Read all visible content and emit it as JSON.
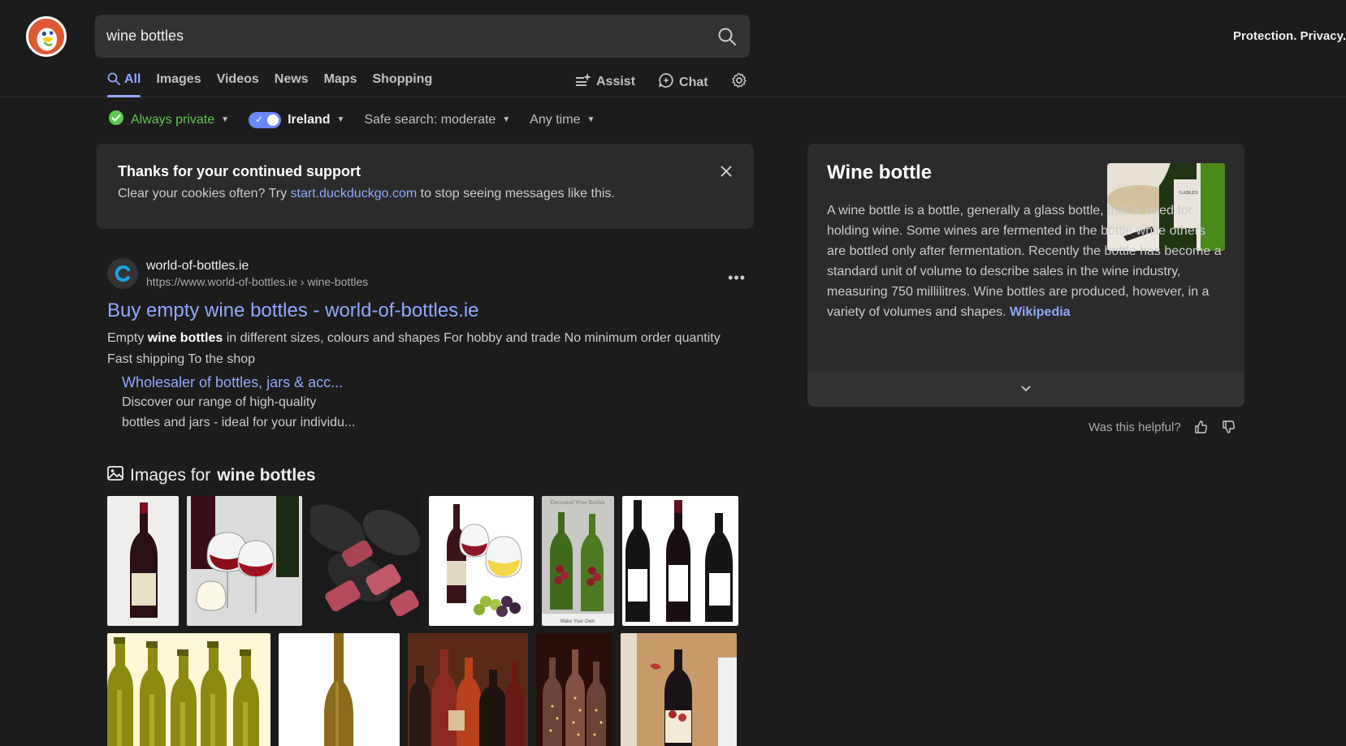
{
  "header": {
    "search_value": "wine bottles",
    "tagline": "Protection. Privacy."
  },
  "tabs": [
    {
      "label": "All",
      "active": true
    },
    {
      "label": "Images"
    },
    {
      "label": "Videos"
    },
    {
      "label": "News"
    },
    {
      "label": "Maps"
    },
    {
      "label": "Shopping"
    }
  ],
  "tools": {
    "assist": "Assist",
    "chat": "Chat"
  },
  "filters": {
    "privacy": "Always private",
    "region": "Ireland",
    "safe_search": "Safe search: moderate",
    "time": "Any time"
  },
  "notice": {
    "title": "Thanks for your continued support",
    "text_before": "Clear your cookies often? Try ",
    "link": "start.duckduckgo.com",
    "text_after": " to stop seeing messages like this."
  },
  "result": {
    "site_name": "world-of-bottles.ie",
    "url": "https://www.world-of-bottles.ie › wine-bottles",
    "title": "Buy empty wine bottles - world-of-bottles.ie",
    "snippet_before": "Empty ",
    "snippet_bold": "wine bottles",
    "snippet_after": " in different sizes, colours and shapes For hobby and trade No minimum order quantity Fast shipping To the shop",
    "sublink_title": "Wholesaler of bottles, jars & acc...",
    "sublink_desc_line1": "Discover our range of high-quality",
    "sublink_desc_line2": "bottles and jars - ideal for your individu..."
  },
  "images_section": {
    "prefix": "Images for ",
    "query": "wine bottles",
    "thumb4_caption": "Decorated Wine Bottles",
    "thumb4_footer": "Make Your Own"
  },
  "knowledge_panel": {
    "title": "Wine bottle",
    "description": "A wine bottle is a bottle, generally a glass bottle, that is used for holding wine. Some wines are fermented in the bottle while others are bottled only after fermentation. Recently the bottle has become a standard unit of volume to describe sales in the wine industry, measuring 750 millilitres. Wine bottles are produced, however, in a variety of volumes and shapes.",
    "source": "Wikipedia",
    "label_text": "GABLES"
  },
  "feedback": {
    "question": "Was this helpful?"
  },
  "colors": {
    "background": "#1c1c1c",
    "card": "#2b2b2b",
    "link": "#8fa9ff",
    "private_green": "#5cc84f",
    "brand_orange": "#de5833"
  }
}
